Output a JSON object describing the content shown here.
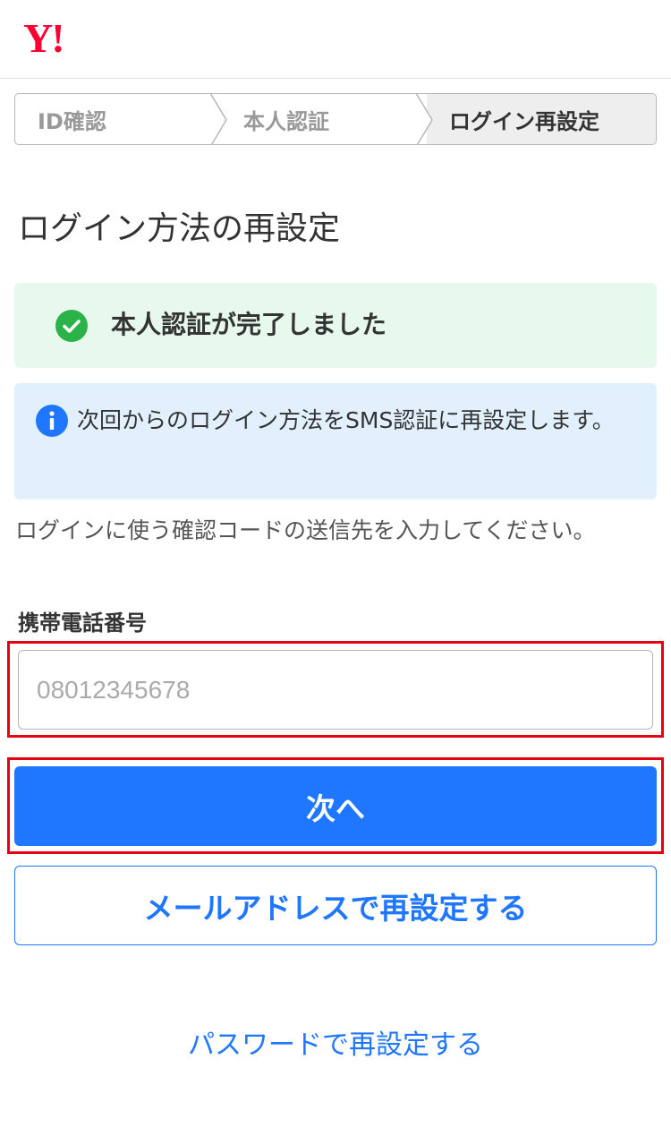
{
  "header": {
    "logo_text": "Y!",
    "logo_color": "#ff0033"
  },
  "stepper": {
    "steps": [
      {
        "label": "ID確認",
        "active": false
      },
      {
        "label": "本人認証",
        "active": false
      },
      {
        "label": "ログイン再設定",
        "active": true
      }
    ]
  },
  "main": {
    "title": "ログイン方法の再設定",
    "success_message": "本人認証が完了しました",
    "info_message": "次回からのログイン方法をSMS認証に再設定します。",
    "instruction": "ログインに使う確認コードの送信先を入力してください。",
    "phone_label": "携帯電話番号",
    "phone_value": "",
    "phone_placeholder": "08012345678",
    "next_button": "次へ",
    "email_button": "メールアドレスで再設定する",
    "password_link": "パスワードで再設定する"
  },
  "colors": {
    "primary": "#1f76ff",
    "success_bg": "#e6f9ec",
    "success_icon": "#2bb34a",
    "info_bg": "#e2f0fe",
    "info_icon": "#1f76ff",
    "highlight": "#e60012"
  },
  "icons": {
    "success": "check-circle-icon",
    "info": "info-icon",
    "step_separator": "chevron-right-icon"
  }
}
